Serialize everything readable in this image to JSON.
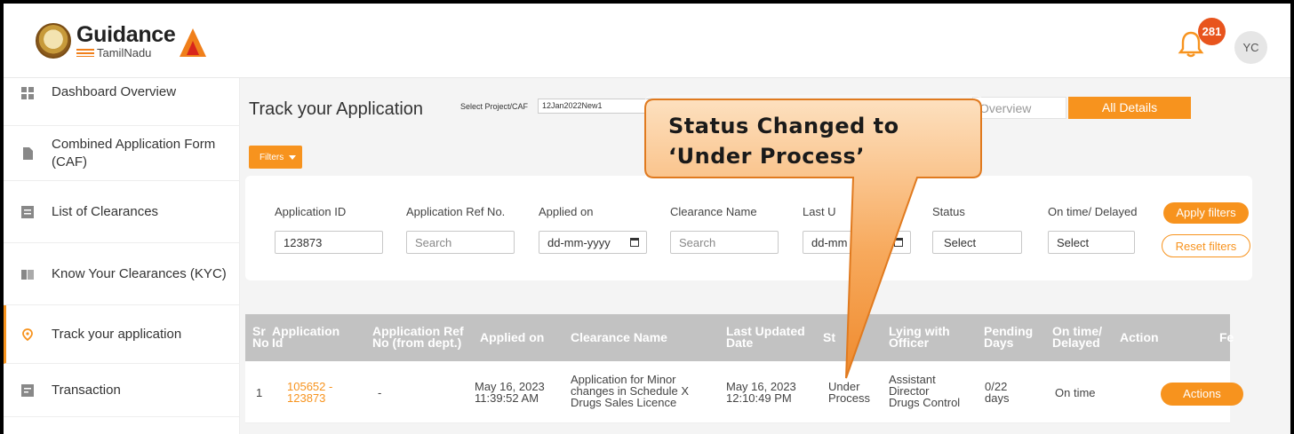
{
  "header": {
    "logo_main": "Guidance",
    "logo_sub": "TamilNadu",
    "notification_count": "281",
    "avatar_initials": "YC"
  },
  "sidebar": {
    "items": [
      {
        "label": "Dashboard Overview",
        "icon": "grid-icon"
      },
      {
        "label": "Combined Application Form (CAF)",
        "icon": "document-icon"
      },
      {
        "label": "List of Clearances",
        "icon": "list-icon"
      },
      {
        "label": "Know Your Clearances (KYC)",
        "icon": "book-icon"
      },
      {
        "label": "Track your application",
        "icon": "location-pin-icon",
        "active": true
      },
      {
        "label": "Transaction",
        "icon": "receipt-icon"
      }
    ]
  },
  "main": {
    "title": "Track your Application",
    "project_label": "Select Project/CAF",
    "project_value": "12Jan2022New1",
    "tabs": [
      {
        "label": "Overview",
        "active": false
      },
      {
        "label": "All Details",
        "active": true
      }
    ],
    "filters_button": "Filters"
  },
  "filters": {
    "application_id": {
      "label": "Application ID",
      "value": "123873"
    },
    "application_ref": {
      "label": "Application Ref No.",
      "placeholder": "Search"
    },
    "applied_on": {
      "label": "Applied on",
      "placeholder": "dd-mm-yyyy"
    },
    "clearance_name": {
      "label": "Clearance Name",
      "placeholder": "Search"
    },
    "last_updated": {
      "label": "Last U",
      "placeholder": "dd-mm"
    },
    "status": {
      "label": "Status",
      "value": "Select"
    },
    "on_time": {
      "label": "On time/ Delayed",
      "value": "Select"
    },
    "apply_label": "Apply filters",
    "reset_label": "Reset filters"
  },
  "table": {
    "headers": {
      "sr": "Sr No",
      "app_id": "Application Id",
      "app_ref": "Application Ref No (from dept.)",
      "applied_on": "Applied on",
      "clearance": "Clearance Name",
      "last_updated": "Last Updated Date",
      "status": "St    s",
      "lying_with": "Lying with Officer",
      "pending": "Pending Days",
      "on_time": "On time/ Delayed",
      "action": "Action",
      "fee": "Fe"
    },
    "rows": [
      {
        "sr": "1",
        "app_id_1": "105652 -",
        "app_id_2": "123873",
        "app_ref": "-",
        "applied_on_1": "May 16, 2023",
        "applied_on_2": "11:39:52 AM",
        "clearance_1": "Application for Minor",
        "clearance_2": "changes in Schedule X",
        "clearance_3": "Drugs Sales Licence",
        "updated_1": "May 16, 2023",
        "updated_2": "12:10:49 PM",
        "status_1": "Under",
        "status_2": "Process",
        "officer_1": "Assistant",
        "officer_2": "Director",
        "officer_3": "Drugs Control",
        "pending_1": "0/22",
        "pending_2": "days",
        "on_time": "On time",
        "action_label": "Actions",
        "fee": "–"
      }
    ]
  },
  "callout": {
    "line1": "Status Changed to",
    "line2": "‘Under Process’"
  },
  "colors": {
    "accent": "#f7931e",
    "badge": "#e8541d",
    "table_header": "#c2c2c2"
  }
}
